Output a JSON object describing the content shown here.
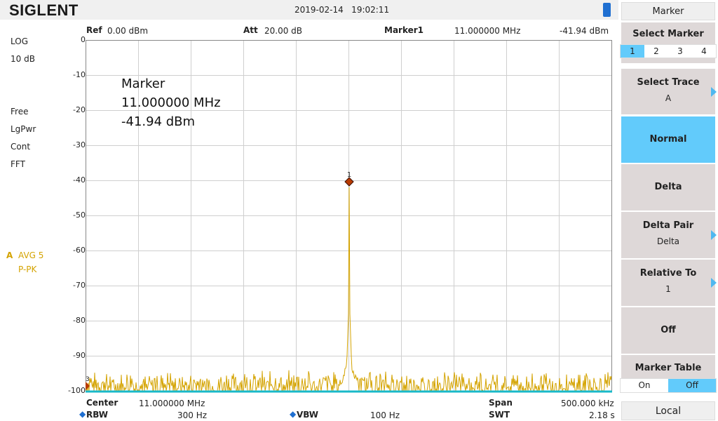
{
  "header": {
    "logo": "SIGLENT",
    "datetime": "2019-02-14   19:02:11"
  },
  "left": {
    "scale": "LOG",
    "div": "10 dB",
    "det1": "Free",
    "det2": "LgPwr",
    "det3": "Cont",
    "det4": "FFT",
    "trace_id": "A",
    "trace_avg": "AVG 5",
    "trace_mode": "P-PK"
  },
  "top_info": {
    "ref_label": "Ref",
    "ref_value": "0.00 dBm",
    "att_label": "Att",
    "att_value": "20.00 dB",
    "marker_label": "Marker1",
    "marker_freq": "11.000000 MHz",
    "marker_amp": "-41.94 dBm"
  },
  "y_ticks": [
    "0",
    "-10",
    "-20",
    "-30",
    "-40",
    "-50",
    "-60",
    "-70",
    "-80",
    "-90",
    "-100"
  ],
  "marker_readout": {
    "title": "Marker",
    "freq": "11.000000 MHz",
    "amp": "-41.94 dBm",
    "marker_num": "1",
    "edge_label": "3"
  },
  "trace": {
    "color": "#d4a300",
    "peak_dbm": -41.94,
    "noise_floor_dbm": -98,
    "ref_dbm": 0,
    "bottom_dbm": -100
  },
  "bottom": {
    "center_label": "Center",
    "center_value": "11.000000 MHz",
    "span_label": "Span",
    "span_value": "500.000 kHz",
    "rbw_label": "RBW",
    "rbw_value": "300 Hz",
    "vbw_label": "VBW",
    "vbw_value": "100 Hz",
    "swt_label": "SWT",
    "swt_value": "2.18 s"
  },
  "menu": {
    "title": "Marker",
    "select_marker": "Select Marker",
    "markers": [
      "1",
      "2",
      "3",
      "4"
    ],
    "select_trace": "Select Trace",
    "select_trace_value": "A",
    "normal": "Normal",
    "delta": "Delta",
    "delta_pair": "Delta Pair",
    "delta_pair_value": "Delta",
    "relative_to": "Relative To",
    "relative_to_value": "1",
    "off": "Off",
    "marker_table": "Marker Table",
    "table_on": "On",
    "table_off": "Off",
    "local": "Local"
  },
  "colors": {
    "accent": "#62cbfb",
    "trace": "#d4a300",
    "marker": "#b83a00"
  }
}
